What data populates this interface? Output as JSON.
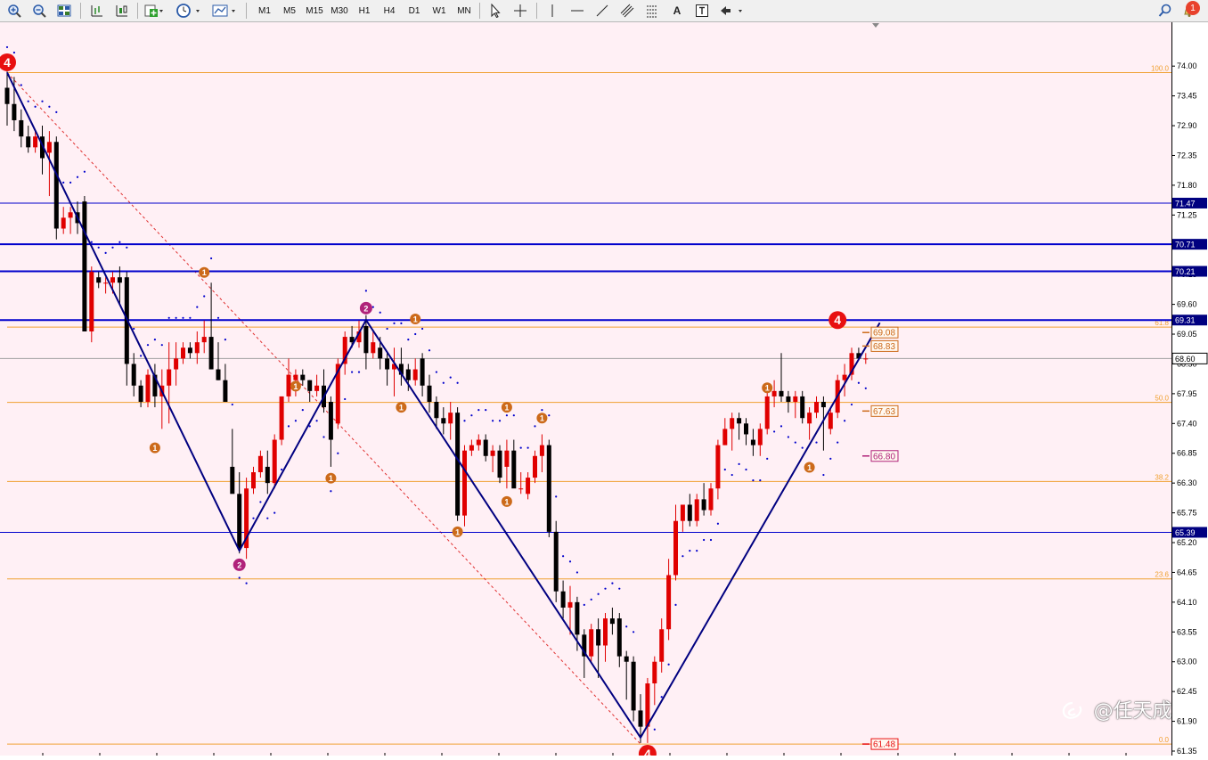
{
  "toolbar": {
    "timeframes": [
      "M1",
      "M5",
      "M15",
      "M30",
      "H1",
      "H4",
      "D1",
      "W1",
      "MN"
    ],
    "text_tool_label": "A",
    "notification_count": "1",
    "icons": [
      "zoom-in-icon",
      "zoom-out-icon",
      "tile-windows-icon",
      "bar-chart-icon",
      "candlestick-chart-icon",
      "new-order-icon",
      "clock-icon",
      "templates-icon",
      "cursor-icon",
      "crosshair-icon",
      "vertical-line-icon",
      "horizontal-line-icon",
      "trendline-icon",
      "channel-icon",
      "fibonacci-icon",
      "text-label-icon",
      "arrows-icon",
      "search-icon",
      "bell-icon"
    ]
  },
  "colors": {
    "background": "#fff0f5",
    "bull": "#e00000",
    "bear": "#000000",
    "zigzag": "#000080",
    "fib": "#f0a030",
    "hline": "#0000cc",
    "sar": "#0000cc",
    "wave1": "#cc6a1a",
    "wave2": "#b0227a",
    "wave4": "#e81010"
  },
  "chart_data": {
    "type": "candlestick",
    "ylim": [
      61.35,
      74.25
    ],
    "y_ticks": [
      "74.00",
      "73.45",
      "72.90",
      "72.35",
      "71.80",
      "71.25",
      "70.70",
      "70.15",
      "69.60",
      "69.05",
      "68.50",
      "67.95",
      "67.40",
      "66.85",
      "66.30",
      "65.75",
      "65.20",
      "64.65",
      "64.10",
      "63.55",
      "63.00",
      "62.45",
      "61.90",
      "61.35"
    ],
    "horizontal_lines": [
      {
        "price": 71.47,
        "label": "71.47",
        "weight": "thin"
      },
      {
        "price": 70.71,
        "label": "70.71",
        "weight": "bold"
      },
      {
        "price": 70.21,
        "label": "70.21",
        "weight": "bold"
      },
      {
        "price": 69.31,
        "label": "69.31",
        "weight": "bold"
      },
      {
        "price": 65.39,
        "label": "65.39",
        "weight": "thin"
      }
    ],
    "current_price": {
      "price": 68.6,
      "label": "68.60"
    },
    "fibonacci": [
      {
        "level": "100.0",
        "price": 73.88
      },
      {
        "level": "61.8",
        "price": 69.18
      },
      {
        "level": "50.0",
        "price": 67.79
      },
      {
        "level": "38.2",
        "price": 66.33
      },
      {
        "level": "23.6",
        "price": 64.53
      },
      {
        "level": "0.0",
        "price": 61.48
      }
    ],
    "price_labels": [
      {
        "price": 69.08,
        "label": "69.08",
        "color": "#cc6a1a"
      },
      {
        "price": 68.83,
        "label": "68.83",
        "color": "#cc6a1a"
      },
      {
        "price": 67.63,
        "label": "67.63",
        "color": "#cc6a1a"
      },
      {
        "price": 66.8,
        "label": "66.80",
        "color": "#b0227a"
      },
      {
        "price": 61.48,
        "label": "61.48",
        "color": "#e81010"
      }
    ],
    "zigzag": [
      {
        "bar": 0,
        "price": 73.88
      },
      {
        "bar": 33,
        "price": 65.05
      },
      {
        "bar": 51,
        "price": 69.31
      },
      {
        "bar": 90,
        "price": 61.6
      },
      {
        "bar": 124,
        "price": 69.26
      }
    ],
    "wave_markers": [
      {
        "bar": 0,
        "price": 74.07,
        "label": "4",
        "kind": "wave4"
      },
      {
        "bar": 28,
        "price": 70.19,
        "label": "1",
        "kind": "wave1"
      },
      {
        "bar": 21,
        "price": 66.95,
        "label": "1",
        "kind": "wave1"
      },
      {
        "bar": 41,
        "price": 68.09,
        "label": "1",
        "kind": "wave1"
      },
      {
        "bar": 46,
        "price": 66.39,
        "label": "1",
        "kind": "wave1"
      },
      {
        "bar": 33,
        "price": 64.79,
        "label": "2",
        "kind": "wave2"
      },
      {
        "bar": 51,
        "price": 69.53,
        "label": "2",
        "kind": "wave2"
      },
      {
        "bar": 58,
        "price": 69.33,
        "label": "1",
        "kind": "wave1"
      },
      {
        "bar": 56,
        "price": 67.7,
        "label": "1",
        "kind": "wave1"
      },
      {
        "bar": 71,
        "price": 67.7,
        "label": "1",
        "kind": "wave1"
      },
      {
        "bar": 76,
        "price": 67.5,
        "label": "1",
        "kind": "wave1"
      },
      {
        "bar": 71,
        "price": 65.96,
        "label": "1",
        "kind": "wave1"
      },
      {
        "bar": 64,
        "price": 65.4,
        "label": "1",
        "kind": "wave1"
      },
      {
        "bar": 108,
        "price": 68.06,
        "label": "1",
        "kind": "wave1"
      },
      {
        "bar": 114,
        "price": 66.59,
        "label": "1",
        "kind": "wave1"
      },
      {
        "bar": 118,
        "price": 69.31,
        "label": "4",
        "kind": "wave4"
      },
      {
        "bar": 91,
        "price": 61.3,
        "label": "4",
        "kind": "wave4"
      }
    ],
    "candles": [
      [
        73.6,
        73.9,
        72.9,
        73.3
      ],
      [
        73.3,
        73.8,
        72.8,
        73.0
      ],
      [
        73.0,
        73.2,
        72.5,
        72.7
      ],
      [
        72.7,
        72.9,
        72.4,
        72.5
      ],
      [
        72.5,
        72.8,
        72.4,
        72.7
      ],
      [
        72.7,
        72.9,
        72.0,
        72.3
      ],
      [
        72.4,
        72.8,
        71.6,
        72.6
      ],
      [
        72.6,
        72.7,
        70.8,
        71.0
      ],
      [
        71.0,
        71.4,
        70.9,
        71.2
      ],
      [
        71.2,
        71.4,
        70.9,
        71.3
      ],
      [
        71.3,
        71.5,
        70.9,
        71.1
      ],
      [
        71.5,
        71.6,
        69.2,
        69.1
      ],
      [
        69.1,
        70.3,
        68.9,
        70.2
      ],
      [
        70.1,
        70.2,
        69.9,
        70.0
      ],
      [
        70.0,
        70.1,
        69.8,
        70.0
      ],
      [
        70.0,
        70.2,
        69.8,
        70.1
      ],
      [
        70.1,
        70.3,
        69.6,
        70.0
      ],
      [
        70.1,
        70.2,
        68.1,
        68.5
      ],
      [
        68.5,
        68.7,
        67.9,
        68.1
      ],
      [
        68.1,
        68.2,
        67.7,
        67.8
      ],
      [
        67.8,
        68.4,
        67.7,
        68.3
      ],
      [
        68.3,
        68.5,
        67.7,
        67.9
      ],
      [
        67.9,
        68.4,
        67.3,
        68.1
      ],
      [
        68.1,
        68.9,
        67.4,
        68.4
      ],
      [
        68.4,
        68.9,
        68.1,
        68.6
      ],
      [
        68.6,
        68.9,
        68.5,
        68.8
      ],
      [
        68.8,
        68.9,
        68.6,
        68.7
      ],
      [
        68.7,
        69.1,
        68.5,
        68.9
      ],
      [
        68.9,
        69.3,
        68.7,
        69.0
      ],
      [
        69.0,
        70.0,
        68.4,
        68.4
      ],
      [
        68.4,
        68.9,
        68.2,
        68.2
      ],
      [
        68.2,
        68.5,
        67.8,
        67.8
      ],
      [
        66.6,
        67.3,
        66.3,
        66.1
      ],
      [
        66.1,
        66.5,
        65.0,
        65.1
      ],
      [
        65.1,
        66.4,
        64.9,
        66.2
      ],
      [
        66.2,
        66.6,
        66.1,
        66.5
      ],
      [
        66.5,
        66.9,
        66.4,
        66.8
      ],
      [
        66.6,
        66.9,
        66.1,
        66.3
      ],
      [
        66.3,
        67.2,
        66.2,
        67.1
      ],
      [
        67.1,
        67.9,
        67.0,
        67.9
      ],
      [
        67.9,
        68.6,
        67.8,
        68.3
      ],
      [
        68.2,
        68.4,
        67.9,
        68.3
      ],
      [
        68.3,
        68.4,
        68.1,
        68.2
      ],
      [
        68.2,
        68.2,
        67.8,
        68.0
      ],
      [
        68.0,
        68.3,
        67.9,
        68.1
      ],
      [
        68.1,
        68.4,
        67.6,
        67.7
      ],
      [
        67.8,
        67.9,
        66.6,
        67.1
      ],
      [
        67.4,
        68.6,
        67.3,
        68.5
      ],
      [
        68.5,
        69.1,
        68.3,
        69.0
      ],
      [
        69.0,
        69.2,
        68.8,
        68.9
      ],
      [
        68.9,
        69.3,
        68.8,
        69.1
      ],
      [
        69.2,
        69.4,
        68.4,
        68.7
      ],
      [
        68.7,
        69.1,
        68.6,
        68.9
      ],
      [
        68.8,
        69.0,
        68.4,
        68.6
      ],
      [
        68.6,
        68.7,
        68.1,
        68.4
      ],
      [
        68.4,
        68.8,
        67.9,
        68.5
      ],
      [
        68.5,
        68.8,
        68.1,
        68.3
      ],
      [
        68.4,
        68.5,
        68.0,
        68.2
      ],
      [
        68.2,
        68.6,
        68.1,
        68.4
      ],
      [
        68.6,
        68.7,
        67.9,
        68.1
      ],
      [
        68.1,
        68.3,
        67.6,
        67.8
      ],
      [
        67.8,
        67.9,
        67.3,
        67.5
      ],
      [
        67.5,
        67.7,
        67.2,
        67.4
      ],
      [
        67.4,
        67.8,
        67.1,
        67.6
      ],
      [
        67.6,
        67.7,
        65.6,
        65.7
      ],
      [
        65.7,
        67.0,
        65.5,
        66.9
      ],
      [
        66.9,
        67.1,
        66.8,
        67.0
      ],
      [
        67.0,
        67.2,
        66.9,
        67.1
      ],
      [
        67.1,
        67.2,
        66.7,
        66.8
      ],
      [
        66.8,
        67.0,
        66.5,
        66.9
      ],
      [
        66.9,
        67.0,
        66.3,
        66.4
      ],
      [
        66.6,
        67.1,
        66.2,
        66.9
      ],
      [
        66.9,
        67.1,
        66.3,
        66.2
      ],
      [
        66.2,
        66.5,
        66.1,
        66.2
      ],
      [
        66.1,
        66.5,
        66.0,
        66.4
      ],
      [
        66.4,
        66.9,
        66.3,
        66.8
      ],
      [
        66.8,
        67.2,
        66.5,
        67.0
      ],
      [
        67.0,
        67.1,
        65.3,
        65.4
      ],
      [
        65.4,
        65.6,
        64.1,
        64.3
      ],
      [
        64.3,
        64.5,
        63.8,
        64.0
      ],
      [
        64.0,
        64.4,
        63.5,
        64.1
      ],
      [
        64.1,
        64.2,
        63.2,
        63.5
      ],
      [
        63.5,
        63.6,
        62.7,
        63.1
      ],
      [
        63.1,
        63.7,
        63.0,
        63.6
      ],
      [
        63.6,
        63.8,
        62.7,
        63.3
      ],
      [
        63.3,
        63.9,
        63.0,
        63.8
      ],
      [
        63.8,
        64.0,
        63.5,
        63.7
      ],
      [
        63.8,
        63.9,
        62.9,
        63.1
      ],
      [
        63.1,
        63.2,
        62.3,
        63.0
      ],
      [
        63.0,
        63.1,
        61.9,
        62.1
      ],
      [
        62.1,
        62.4,
        61.5,
        61.8
      ],
      [
        61.8,
        62.7,
        61.5,
        62.6
      ],
      [
        62.6,
        63.1,
        62.2,
        63.0
      ],
      [
        63.0,
        63.8,
        62.8,
        63.6
      ],
      [
        63.6,
        64.9,
        63.4,
        64.6
      ],
      [
        64.6,
        65.9,
        64.5,
        65.6
      ],
      [
        65.6,
        65.9,
        65.4,
        65.9
      ],
      [
        65.9,
        66.1,
        65.5,
        65.6
      ],
      [
        65.6,
        66.1,
        65.5,
        66.0
      ],
      [
        66.0,
        66.3,
        65.7,
        65.8
      ],
      [
        65.8,
        66.3,
        65.7,
        66.2
      ],
      [
        66.2,
        67.1,
        66.0,
        67.0
      ],
      [
        67.0,
        67.5,
        67.0,
        67.3
      ],
      [
        67.3,
        67.6,
        66.9,
        67.5
      ],
      [
        67.5,
        67.6,
        67.1,
        67.4
      ],
      [
        67.4,
        67.5,
        67.0,
        67.2
      ],
      [
        67.1,
        67.3,
        66.8,
        67.0
      ],
      [
        67.0,
        67.4,
        66.8,
        67.3
      ],
      [
        67.3,
        68.1,
        67.2,
        67.9
      ],
      [
        67.9,
        68.2,
        67.7,
        68.0
      ],
      [
        68.0,
        68.7,
        67.8,
        67.9
      ],
      [
        67.9,
        68.0,
        67.6,
        67.8
      ],
      [
        67.8,
        68.0,
        67.5,
        67.9
      ],
      [
        67.9,
        68.0,
        67.4,
        67.5
      ],
      [
        67.4,
        67.7,
        67.1,
        67.6
      ],
      [
        67.6,
        67.9,
        67.5,
        67.8
      ],
      [
        67.8,
        67.9,
        66.9,
        67.7
      ],
      [
        67.3,
        67.7,
        67.2,
        67.6
      ],
      [
        67.6,
        68.3,
        67.5,
        68.2
      ],
      [
        68.2,
        68.5,
        67.9,
        68.3
      ],
      [
        68.3,
        68.8,
        68.2,
        68.7
      ],
      [
        68.7,
        68.8,
        68.6,
        68.6
      ],
      [
        68.6,
        68.7,
        68.5,
        68.6
      ]
    ]
  }
}
